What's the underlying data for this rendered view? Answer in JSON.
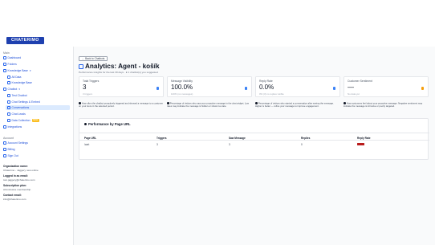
{
  "brand": {
    "logo_text": "CHATERIMO"
  },
  "sidebar": {
    "main_label": "Main",
    "items": [
      {
        "label": "Dashboard",
        "icon": "dashboard-icon"
      },
      {
        "label": "Folders",
        "icon": "folder-icon"
      },
      {
        "label": "Knowledge Base",
        "icon": "book-icon",
        "expandable": true
      },
      {
        "label": "Chatbot",
        "icon": "robot-icon",
        "expandable": true
      },
      {
        "label": "Integrations",
        "icon": "plug-icon"
      }
    ],
    "kb_sub": [
      {
        "label": "All Data"
      },
      {
        "label": "Knowledge Base"
      }
    ],
    "chatbot_sub": [
      {
        "label": "Test Chatbot"
      },
      {
        "label": "Chat Settings & Embed"
      },
      {
        "label": "Conversations"
      },
      {
        "label": "Chat Leads"
      },
      {
        "label": "Data Collection",
        "badge": "NEW"
      }
    ],
    "account_label": "Account",
    "account_items": [
      {
        "label": "Account Settings",
        "icon": "user-icon"
      },
      {
        "label": "Billing",
        "icon": "credit-card-icon"
      },
      {
        "label": "Sign Out",
        "icon": "logout-icon"
      }
    ],
    "info": [
      {
        "label": "Organization name:",
        "value": "Chaterimo - Jaggery new online"
      },
      {
        "label": "Logged in as email:",
        "value": "tom.jaggery@chaterimo.com"
      },
      {
        "label": "Subscription plan:",
        "value": "All-inclusive membership"
      },
      {
        "label": "Contact email:",
        "value": "info@chaterimo.com"
      }
    ]
  },
  "main": {
    "back_label": "← Back to Chatbots",
    "title": "Analytics: Agent - košík",
    "subtitle": "Performance insights for the last 30 days · ● 1 chatbot(s) you suggested",
    "cards": [
      {
        "label": "Total Triggers",
        "value": "3",
        "sub": "3 triggers",
        "icon": "cursor-icon",
        "icon_color": "#3b82f6"
      },
      {
        "label": "Message Visibility",
        "value": "100.0%",
        "sub": "100% (no messages)",
        "icon": "eye-icon",
        "icon_color": "#3b82f6"
      },
      {
        "label": "Reply Rate",
        "value": "0.0%",
        "sub": "0% (3) no replies visible",
        "icon": "chat-icon",
        "icon_color": "#3b82f6"
      },
      {
        "label": "Customer Sentiment",
        "value": "—",
        "sub": "No data yet",
        "icon": "sun-icon",
        "icon_color": "#f59e0b"
      }
    ],
    "notes": [
      "How often the chatbot proactively triggered and showed a message to a customer on your store in the selected period.",
      "Percentage of visitors who saw your proactive message in the chat widget. Low rates may indicate the message is hidden or shown too late.",
      "Percentage of visitors who started a conversation after seeing the message. Higher is better — refine your message to improve engagement.",
      "How customers feel about your proactive message. Negative sentiment may indicate the message is intrusive or poorly targeted."
    ],
    "table": {
      "title": "Performance by Page URL",
      "columns": [
        "Page URL",
        "Triggers",
        "Saw Message",
        "Replies",
        "Reply Rate"
      ],
      "rows": [
        {
          "url": "/cart",
          "triggers": "3",
          "saw": "3",
          "replies": "0",
          "reply_rate": 0.0
        }
      ],
      "bar_color": "#b91c1c"
    }
  }
}
